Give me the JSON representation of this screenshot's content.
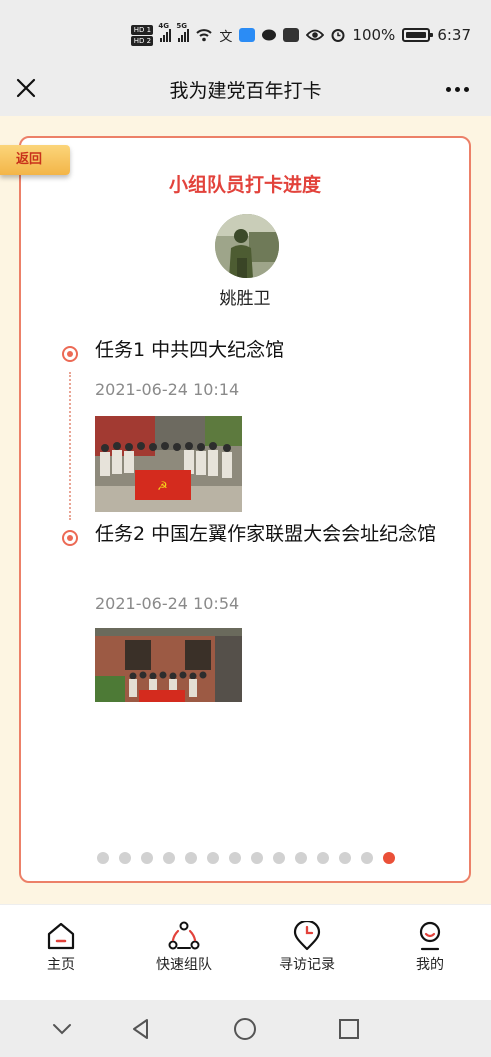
{
  "status_bar": {
    "hd1": "HD 1",
    "hd2": "HD 2",
    "net1": "4G",
    "net2": "5G",
    "battery_text": "100%",
    "time": "6:37"
  },
  "nav": {
    "title": "我为建党百年打卡",
    "close_icon": "close-icon",
    "more_icon": "more-icon"
  },
  "card": {
    "back_label": "返回",
    "title": "小组队员打卡进度",
    "member_name": "姚胜卫",
    "tasks": [
      {
        "name": "任务1 中共四大纪念馆",
        "time": "2021-06-24 10:14"
      },
      {
        "name": "任务2 中国左翼作家联盟大会会址纪念馆",
        "time": "2021-06-24 10:54"
      }
    ],
    "pager": {
      "total": 14,
      "current_index": 13
    }
  },
  "tabbar": {
    "items": [
      {
        "label": "主页",
        "icon": "home-icon"
      },
      {
        "label": "快速组队",
        "icon": "team-icon"
      },
      {
        "label": "寻访记录",
        "icon": "record-icon"
      },
      {
        "label": "我的",
        "icon": "profile-icon"
      }
    ]
  },
  "colors": {
    "accent": "#e2423b",
    "card_border": "#ec8068",
    "page_bg": "#fdf5e2",
    "back_tag": "#f3b548"
  }
}
